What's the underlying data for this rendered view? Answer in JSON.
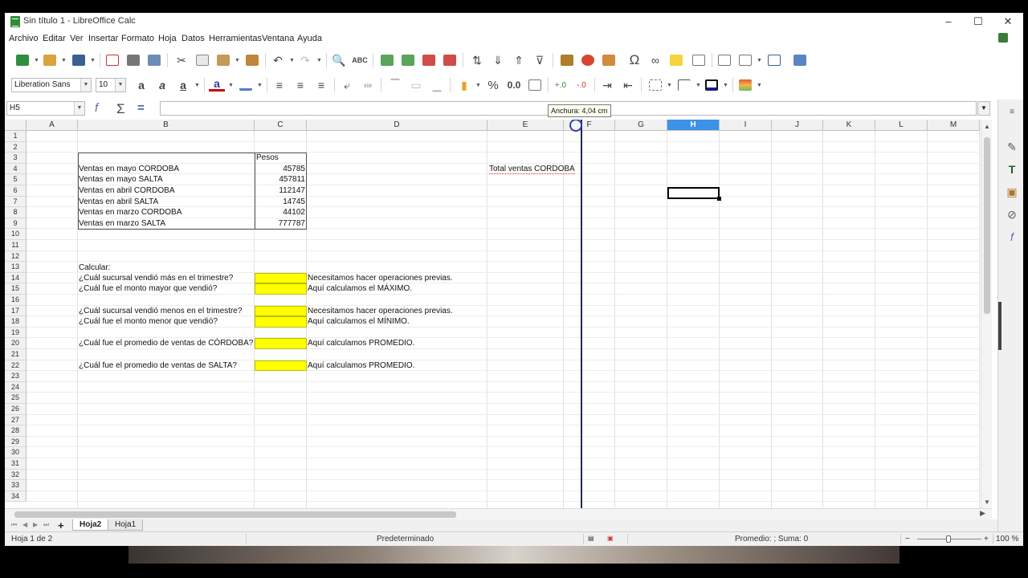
{
  "window": {
    "title": "Sin título 1 - LibreOffice Calc",
    "controls": [
      "–",
      "☐",
      "✕"
    ]
  },
  "menu": [
    "Archivo",
    "Editar",
    "Ver",
    "Insertar",
    "Formato",
    "Hoja",
    "Datos",
    "Herramientas",
    "Ventana",
    "Ayuda"
  ],
  "toolbar2": {
    "font_name": "Liberation Sans",
    "font_size": "10",
    "percent": "%",
    "number": "0.0"
  },
  "formula_bar": {
    "name_box": "H5",
    "input": ""
  },
  "tooltip": "Anchura: 4,04 cm",
  "columns": [
    "A",
    "B",
    "C",
    "D",
    "E",
    "F",
    "G",
    "H",
    "I",
    "J",
    "K",
    "L",
    "M"
  ],
  "selected_column": "H",
  "rows": [
    "1",
    "2",
    "3",
    "4",
    "5",
    "6",
    "7",
    "8",
    "9",
    "10",
    "11",
    "12",
    "13",
    "14",
    "15",
    "16",
    "17",
    "18",
    "19",
    "20",
    "21",
    "22",
    "23",
    "24",
    "25",
    "26",
    "27",
    "28",
    "29",
    "30",
    "31",
    "32",
    "33",
    "34"
  ],
  "cells": {
    "c3": "Pesos",
    "table": [
      {
        "label": "Ventas en mayo CORDOBA",
        "value": "45785"
      },
      {
        "label": "Ventas en mayo SALTA",
        "value": "457811"
      },
      {
        "label": "Ventas en abril CORDOBA",
        "value": "112147"
      },
      {
        "label": "Ventas en abril SALTA",
        "value": "14745"
      },
      {
        "label": "Ventas en marzo  CORDOBA",
        "value": "44102"
      },
      {
        "label": "Ventas en marzo SALTA",
        "value": "777787"
      }
    ],
    "e4": "Total ventas CORDOBA",
    "b13": "Calcular:",
    "questions": [
      {
        "row": "14",
        "q": "¿Cuál sucursal vendió más en el trimestre?",
        "note": "Necesitamos hacer operaciones previas."
      },
      {
        "row": "15",
        "q": "¿Cuál fue el monto mayor que vendió?",
        "note": "Aquí calculamos el MÁXIMO."
      },
      {
        "row": "17",
        "q": "¿Cuál sucursal vendió menos en el trimestre?",
        "note": "Necesitamos hacer operaciones previas."
      },
      {
        "row": "18",
        "q": "¿Cuál fue el monto menor que vendió?",
        "note": "Aquí calculamos el MÍNIMO."
      },
      {
        "row": "20",
        "q": "¿Cuál fue el promedio de ventas de CÓRDOBA?",
        "note": "Aquí calculamos PROMEDIO."
      },
      {
        "row": "22",
        "q": "¿Cuál fue el promedio de ventas de SALTA?",
        "note": "Aquí calculamos PROMEDIO."
      }
    ]
  },
  "sheets": {
    "add": "+",
    "tabs": [
      "Hoja2",
      "Hoja1"
    ],
    "active": "Hoja2"
  },
  "status": {
    "sheet_info": "Hoja 1 de 2",
    "page_style": "Predeterminado",
    "summary": "Promedio: ; Suma: 0",
    "zoom_minus": "−",
    "zoom_plus": "+",
    "zoom": "100 %"
  },
  "colors": {
    "yellow_fill": "#ffff00",
    "header_selected": "#3d91e6"
  }
}
